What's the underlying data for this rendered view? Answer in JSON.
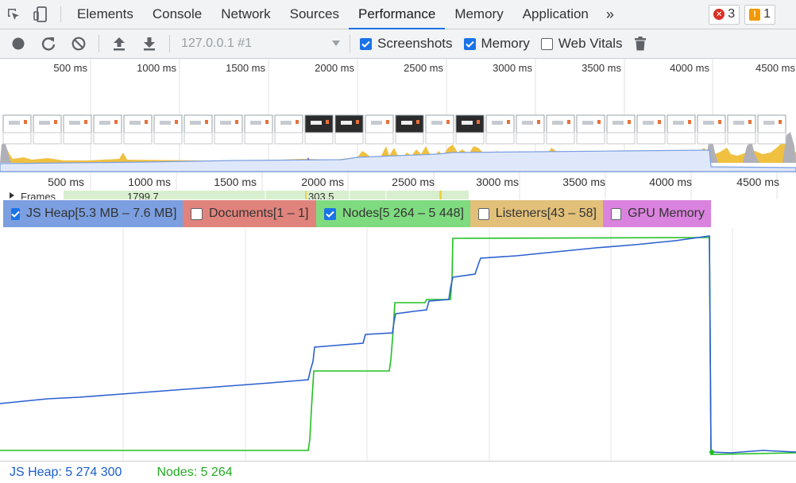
{
  "tabs": {
    "items": [
      {
        "label": "Elements"
      },
      {
        "label": "Console"
      },
      {
        "label": "Network"
      },
      {
        "label": "Sources"
      },
      {
        "label": "Performance",
        "active": true
      },
      {
        "label": "Memory"
      },
      {
        "label": "Application"
      }
    ],
    "more_label": "»",
    "error_count": "3",
    "warning_count": "1"
  },
  "toolbar": {
    "profile_target": "127.0.0.1 #1",
    "screenshots_label": "Screenshots",
    "screenshots_checked": true,
    "memory_label": "Memory",
    "memory_checked": true,
    "webvitals_label": "Web Vitals",
    "webvitals_checked": false
  },
  "overview": {
    "ticks": [
      "500 ms",
      "1000 ms",
      "1500 ms",
      "2000 ms",
      "2500 ms",
      "3000 ms",
      "3500 ms",
      "4000 ms",
      "4500 ms"
    ]
  },
  "timeline": {
    "ticks": [
      "500 ms",
      "1000 ms",
      "1500 ms",
      "2000 ms",
      "2500 ms",
      "3000 ms",
      "3500 ms",
      "4000 ms",
      "4500 ms"
    ],
    "frames_label": "Frames",
    "frame_values": [
      "1799.7",
      "303.5"
    ]
  },
  "counters": {
    "js_heap": {
      "label": "JS Heap[5.3 MB – 7.6 MB]",
      "checked": true,
      "color": "#1a5fcb",
      "bg": "#7b9fe0"
    },
    "documents": {
      "label": "Documents[1 – 1]",
      "checked": false,
      "color": "#c33",
      "bg": "#e0837c"
    },
    "nodes": {
      "label": "Nodes[5 264 – 5 448]",
      "checked": true,
      "color": "#20b020",
      "bg": "#7fdb7f"
    },
    "listeners": {
      "label": "Listeners[43 – 58]",
      "checked": false,
      "color": "#b07a1a",
      "bg": "#e2c07a"
    },
    "gpu": {
      "label": "GPU Memory",
      "checked": false,
      "color": "#a33ca3",
      "bg": "#da83de"
    }
  },
  "status": {
    "js_heap": "JS Heap: 5 274 300",
    "nodes": "Nodes: 5 264"
  }
}
